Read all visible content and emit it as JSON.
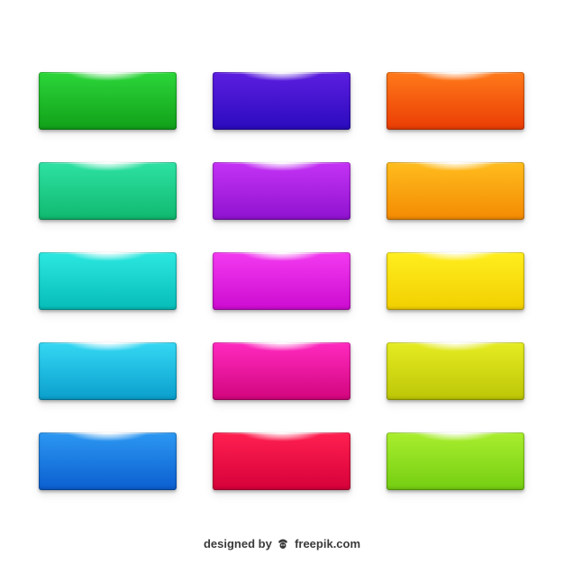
{
  "buttons": [
    {
      "id": "green",
      "top": "#2cd63a",
      "bottom": "#11a019"
    },
    {
      "id": "indigo",
      "top": "#5d1ee0",
      "bottom": "#2a0bbd"
    },
    {
      "id": "orange",
      "top": "#ff7a1a",
      "bottom": "#ea3c04"
    },
    {
      "id": "emerald",
      "top": "#2ee2a4",
      "bottom": "#10b86e"
    },
    {
      "id": "purple",
      "top": "#c533f5",
      "bottom": "#8e12cf"
    },
    {
      "id": "amber",
      "top": "#ffbd1e",
      "bottom": "#f48a02"
    },
    {
      "id": "turquoise",
      "top": "#2ce8e0",
      "bottom": "#06bcb8"
    },
    {
      "id": "magenta",
      "top": "#f33af0",
      "bottom": "#cc0bd0"
    },
    {
      "id": "yellow",
      "top": "#ffee1e",
      "bottom": "#f2cf00"
    },
    {
      "id": "sky",
      "top": "#35d8f4",
      "bottom": "#0a9ecc"
    },
    {
      "id": "pink",
      "top": "#ff2ac0",
      "bottom": "#d2057c"
    },
    {
      "id": "lime",
      "top": "#e6ec22",
      "bottom": "#bcc606"
    },
    {
      "id": "blue",
      "top": "#2c98f2",
      "bottom": "#0b5ed0"
    },
    {
      "id": "crimson",
      "top": "#ff2050",
      "bottom": "#d6003a"
    },
    {
      "id": "yellow-green",
      "top": "#a9ee2e",
      "bottom": "#74cd12"
    }
  ],
  "footer": {
    "prefix": "designed by",
    "brand": "freepik.com",
    "icon": "freepik-logo-icon"
  }
}
